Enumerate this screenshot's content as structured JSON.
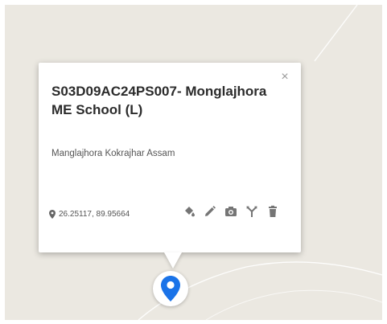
{
  "place": {
    "title": "S03D09AC24PS007- Monglajhora ME School (L)",
    "address": "Manglajhora Kokrajhar Assam",
    "coordinates": "26.25117, 89.95664"
  },
  "window": {
    "close_symbol": "×"
  },
  "icons": {
    "coordinates": "location-pin-icon",
    "actions": [
      "fill-color-icon",
      "pencil-icon",
      "camera-icon",
      "route-fork-icon",
      "trash-icon"
    ],
    "marker": "map-marker-icon"
  },
  "colors": {
    "map_background": "#ebe8e1",
    "marker": "#1a73e8",
    "icon_gray": "#757575"
  }
}
